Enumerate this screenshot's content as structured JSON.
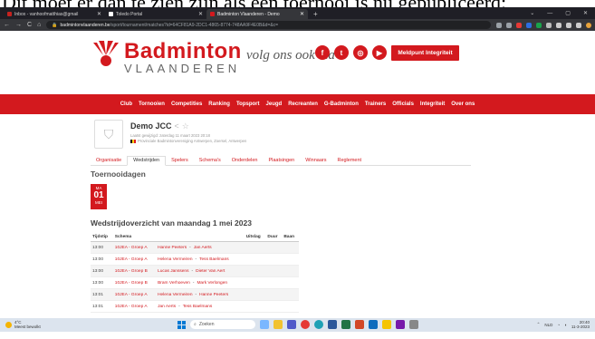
{
  "caption": "Dit moet er dan te zien zijn als een toernooi is nu gepubliceerd:",
  "browser": {
    "tabs": [
      {
        "label": "Inbox - vanhoofmatthias@gmail",
        "color": "#c5221f",
        "active": false
      },
      {
        "label": "Toledo Portal",
        "color": "#ffffff",
        "active": false
      },
      {
        "label": "Badminton Vlaanderen - Demo",
        "color": "#d3191e",
        "active": true
      }
    ],
    "new_tab": "+",
    "window_controls": [
      "⌄",
      "—",
      "▢",
      "✕"
    ],
    "nav_buttons": [
      "←",
      "→",
      "C",
      "⌂"
    ],
    "url_host": "badmintonvlaanderen.be",
    "url_path": "/sport/tournament/matches?id=64CF81A9-2DC1-4865-8774-748AA9F4E0B&d=&c=",
    "bookmarks": [
      {
        "label": "Facebook",
        "color": "#1877f2"
      },
      {
        "label": "Inloggen - Staffcloud",
        "color": "#999999"
      },
      {
        "label": "Fintro",
        "color": "#1a9e4b"
      },
      {
        "label": "TED",
        "color": "#e62b1e"
      },
      {
        "label": "Hobban",
        "color": "#d3191e"
      },
      {
        "label": "Garmin Connect",
        "color": "#3b8fd4"
      },
      {
        "label": "Google",
        "color": "#f5c400"
      },
      {
        "label": "School",
        "color": "#f5c400"
      },
      {
        "label": "Badminton",
        "color": "#f5c400"
      },
      {
        "label": "Spelletjes",
        "color": "#f5c400"
      },
      {
        "label": "Leren",
        "color": "#f5c400"
      },
      {
        "label": "Films",
        "color": "#f5c400"
      },
      {
        "label": "Andere bladwijzers",
        "color": "#f5c400"
      },
      {
        "label": "SMA appanaat",
        "color": "#2f7ddc"
      },
      {
        "label": "WiFi LOGIN",
        "color": "#ffffff"
      }
    ]
  },
  "site": {
    "logo_title": "Badminton",
    "logo_sub": "VLAANDEREN",
    "follow_text": "volg ons ook via",
    "social": [
      {
        "icon": "facebook-icon",
        "glyph": "f"
      },
      {
        "icon": "twitter-icon",
        "glyph": "t"
      },
      {
        "icon": "instagram-icon",
        "glyph": "◎"
      },
      {
        "icon": "youtube-icon",
        "glyph": "▶"
      }
    ],
    "meldpunt": "Meldpunt Integriteit",
    "nav": [
      "Club",
      "Tornooien",
      "Competities",
      "Ranking",
      "Topsport",
      "Jeugd",
      "Recreanten",
      "G-Badminton",
      "Trainers",
      "Officials",
      "Integriteit",
      "Over ons"
    ],
    "accent": "#d3191e"
  },
  "tournament": {
    "name": "Demo JCC",
    "updated": "Laatst gewijzigd: zaterdag 11 maart 2023 20:18",
    "org": "Provinciale Badmintonvereniging Antwerpen, Zoersel, Antwerpen",
    "tabs": [
      "Organisatie",
      "Wedstrijden",
      "Spelers",
      "Schema's",
      "Onderdelen",
      "Plaatsingen",
      "Winnaars",
      "Reglement"
    ],
    "active_tab": 1
  },
  "days": {
    "heading": "Toernooidagen",
    "badge": {
      "weekday": "MA",
      "day": "01",
      "month": "MEI"
    }
  },
  "overview": {
    "heading": "Wedstrijdoverzicht van maandag 1 mei 2023",
    "columns": [
      "Tijdstip",
      "Schema",
      "",
      "Uitslag",
      "Duur",
      "Baan"
    ],
    "rows": [
      {
        "time": "13:00",
        "schema": "10JEA - Groep A",
        "p1": "Hanne Peeters",
        "sep": "-",
        "p2": "Jan Aerts"
      },
      {
        "time": "13:00",
        "schema": "10JEA - Groep A",
        "p1": "Helena Vermeiren",
        "sep": "-",
        "p2": "Tess Baelmans"
      },
      {
        "time": "13:00",
        "schema": "10JEA - Groep B",
        "p1": "Lucas Janssens",
        "sep": "-",
        "p2": "Dieter Van Aert"
      },
      {
        "time": "13:00",
        "schema": "10JEA - Groep B",
        "p1": "Bram Verhoeven",
        "sep": "-",
        "p2": "Mark Verlongen"
      },
      {
        "time": "13:01",
        "schema": "10JEA - Groep A",
        "p1": "Helena Vermeiren",
        "sep": "-",
        "p2": "Hanne Peeters"
      },
      {
        "time": "13:01",
        "schema": "10JEA - Groep A",
        "p1": "Jan Aerts",
        "sep": "-",
        "p2": "Tess Baelmans"
      }
    ]
  },
  "taskbar": {
    "temp": "4°C",
    "weather": "Meest bewolkt",
    "search": "Zoeken",
    "lang": "NLD",
    "time": "20:40",
    "date": "11-3-2023"
  }
}
